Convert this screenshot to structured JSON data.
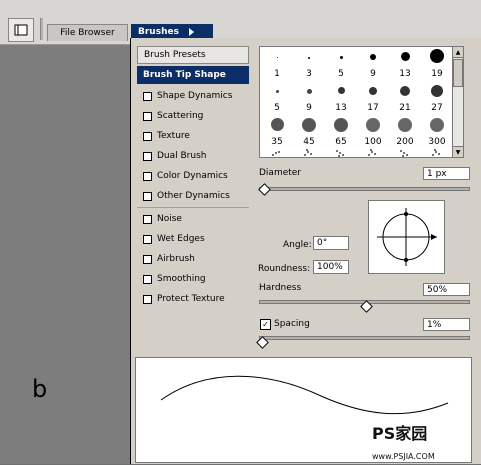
{
  "tabs": {
    "file_browser": "File Browser",
    "brushes": "Brushes"
  },
  "list": {
    "header": "Brush Presets",
    "selected": "Brush Tip Shape",
    "items": [
      "Shape Dynamics",
      "Scattering",
      "Texture",
      "Dual Brush",
      "Color Dynamics",
      "Other Dynamics",
      "Noise",
      "Wet Edges",
      "Airbrush",
      "Smoothing",
      "Protect Texture"
    ]
  },
  "brushes": {
    "row1": [
      "1",
      "3",
      "5",
      "9",
      "13",
      "19"
    ],
    "row2": [
      "5",
      "9",
      "13",
      "17",
      "21",
      "27"
    ],
    "row3": [
      "35",
      "45",
      "65",
      "100",
      "200",
      "300"
    ]
  },
  "diameter": {
    "label": "Diameter",
    "value": "1 px",
    "slider_fraction": 0.02
  },
  "angle": {
    "label": "Angle:",
    "value": "0°"
  },
  "roundness": {
    "label": "Roundness:",
    "value": "100%"
  },
  "hardness": {
    "label": "Hardness",
    "value": "50%",
    "slider_fraction": 0.5
  },
  "spacing": {
    "label": "Spacing",
    "value": "1%",
    "checked": true,
    "slider_fraction": 0.01
  },
  "canvas_letter": "b",
  "watermark": {
    "brand": "PS家园",
    "url": "www.PSJIA.COM"
  }
}
